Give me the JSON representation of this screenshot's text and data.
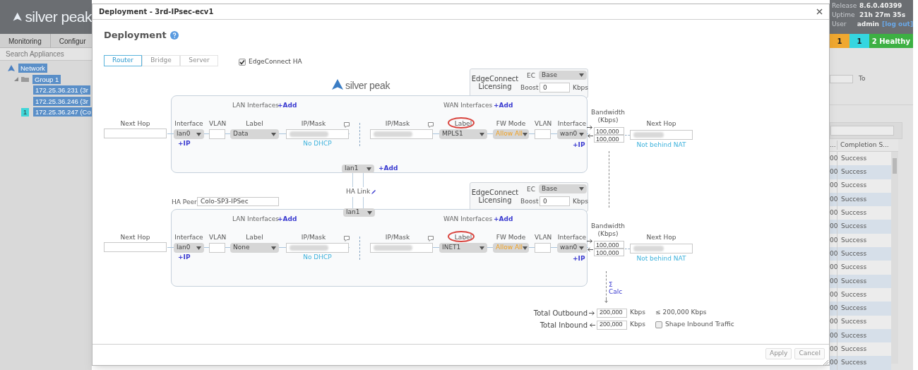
{
  "app": {
    "logo": "silver peak",
    "nav_tabs": [
      {
        "label": "Monitoring"
      },
      {
        "label": "Configur"
      }
    ],
    "search": {
      "placeholder": "Search Appliances"
    },
    "tree": [
      {
        "label": "Network",
        "children": [
          {
            "label": "Group 1",
            "children": [
              {
                "label": "172.25.36.231 (3r"
              },
              {
                "label": "172.25.36.246 (3r"
              },
              {
                "label": "172.25.36.247 (Co",
                "badge": "1"
              }
            ]
          }
        ]
      }
    ],
    "info": [
      {
        "label": "Release",
        "value": "8.6.0.40399"
      },
      {
        "label": "Uptime",
        "value": "21h 27m 35s"
      },
      {
        "label": "User",
        "value": "admin",
        "link": "[log out]"
      }
    ],
    "alarm_counts": [
      {
        "text": "1",
        "color": "#f0a830"
      },
      {
        "text": "1",
        "color": "#35d6e0"
      },
      {
        "text": "2 Healthy",
        "color": "#3db043"
      }
    ],
    "date_filter": {
      "label": "To"
    },
    "table": {
      "columns": [
        "...",
        "Completion S..."
      ],
      "rows": [
        [
          "00",
          "Success"
        ],
        [
          "00",
          "Success"
        ],
        [
          "00",
          "Success"
        ],
        [
          "00",
          "Success"
        ],
        [
          "00",
          "Success"
        ],
        [
          "00",
          "Success"
        ],
        [
          "00",
          "Success"
        ],
        [
          "00",
          "Success"
        ],
        [
          "00",
          "Success"
        ],
        [
          "00",
          "Success"
        ],
        [
          "00",
          "Success"
        ],
        [
          "00",
          "Success"
        ],
        [
          "00",
          "Success"
        ],
        [
          "00",
          "Success"
        ],
        [
          "00",
          "Success"
        ],
        [
          "00",
          "Success"
        ]
      ]
    }
  },
  "dialog": {
    "title": "Deployment - 3rd-IPsec-ecv1",
    "heading": "Deployment",
    "modes": [
      {
        "label": "Router",
        "selected": true
      },
      {
        "label": "Bridge",
        "selected": false
      },
      {
        "label": "Server",
        "selected": false
      }
    ],
    "ha": {
      "label": "EdgeConnect HA",
      "checked": true
    },
    "logo": "silver peak",
    "appliances": [
      {
        "licensing": {
          "title": "EdgeConnect Licensing",
          "ec_label": "EC",
          "ec_value": "Base",
          "boost_label": "Boost",
          "boost_value": "0",
          "unit": "Kbps"
        },
        "lan_next_hop": "Next Hop",
        "lan": {
          "title": "LAN Interfaces",
          "add": "+Add",
          "columns": [
            {
              "label": "Interface"
            },
            {
              "label": "VLAN"
            },
            {
              "label": "Label"
            },
            {
              "label": "IP/Mask"
            }
          ],
          "row": {
            "interface": "lan0",
            "add_ip": "+IP",
            "label": "Data",
            "dhcp": "No DHCP"
          }
        },
        "wan": {
          "title": "WAN Interfaces",
          "add": "+Add",
          "columns": [
            {
              "label": "IP/Mask",
              "circled": false
            },
            {
              "label": "Label",
              "circled": true
            },
            {
              "label": "FW Mode",
              "circled": false
            },
            {
              "label": "VLAN",
              "circled": false
            },
            {
              "label": "Interface",
              "circled": false
            }
          ],
          "row": {
            "label": "MPLS1",
            "fw_mode": "Allow All",
            "interface": "wan0",
            "add_ip": "+IP"
          }
        },
        "bandwidth_label": "Bandwidth (Kbps)",
        "bandwidth_out": "100,000",
        "bandwidth_in": "100,000",
        "wan_next_hop": "Next Hop",
        "nat": "Not behind NAT"
      },
      {
        "licensing": {
          "title": "EdgeConnect Licensing",
          "ec_label": "EC",
          "ec_value": "Base",
          "boost_label": "Boost",
          "boost_value": "0",
          "unit": "Kbps"
        },
        "lan_next_hop": "Next Hop",
        "lan": {
          "title": "LAN Interfaces",
          "add": "+Add",
          "columns": [
            {
              "label": "Interface"
            },
            {
              "label": "VLAN"
            },
            {
              "label": "Label"
            },
            {
              "label": "IP/Mask"
            }
          ],
          "row": {
            "interface": "lan0",
            "add_ip": "+IP",
            "label": "None",
            "dhcp": "No DHCP"
          }
        },
        "wan": {
          "title": "WAN Interfaces",
          "add": "+Add",
          "columns": [
            {
              "label": "IP/Mask",
              "circled": false
            },
            {
              "label": "Label",
              "circled": true
            },
            {
              "label": "FW Mode",
              "circled": false
            },
            {
              "label": "VLAN",
              "circled": false
            },
            {
              "label": "Interface",
              "circled": false
            }
          ],
          "row": {
            "label": "INET1",
            "fw_mode": "Allow All",
            "interface": "wan0",
            "add_ip": "+IP"
          }
        },
        "bandwidth_label": "Bandwidth (Kbps)",
        "bandwidth_out": "100,000",
        "bandwidth_in": "100,000",
        "wan_next_hop": "Next Hop",
        "nat": "Not behind NAT"
      }
    ],
    "ha_link": {
      "top_interface": "lan1",
      "add": "+Add",
      "label": "HA Link",
      "bottom_interface": "lan1"
    },
    "ha_peer": {
      "label": "HA Peer",
      "value": "Colo-SP3-IPSec"
    },
    "calc": {
      "symbol": "Σ",
      "label": "Calc"
    },
    "totals": [
      {
        "kind": "outbound",
        "label": "Total Outbound",
        "value": "200,000",
        "unit": "Kbps",
        "note": "≤ 200,000 Kbps"
      },
      {
        "kind": "inbound",
        "label": "Total Inbound",
        "value": "200,000",
        "unit": "Kbps",
        "option": {
          "label": "Shape Inbound Traffic",
          "checked": false
        }
      }
    ],
    "buttons": [
      {
        "label": "Apply",
        "disabled": true
      },
      {
        "label": "Cancel",
        "disabled": true
      }
    ]
  }
}
